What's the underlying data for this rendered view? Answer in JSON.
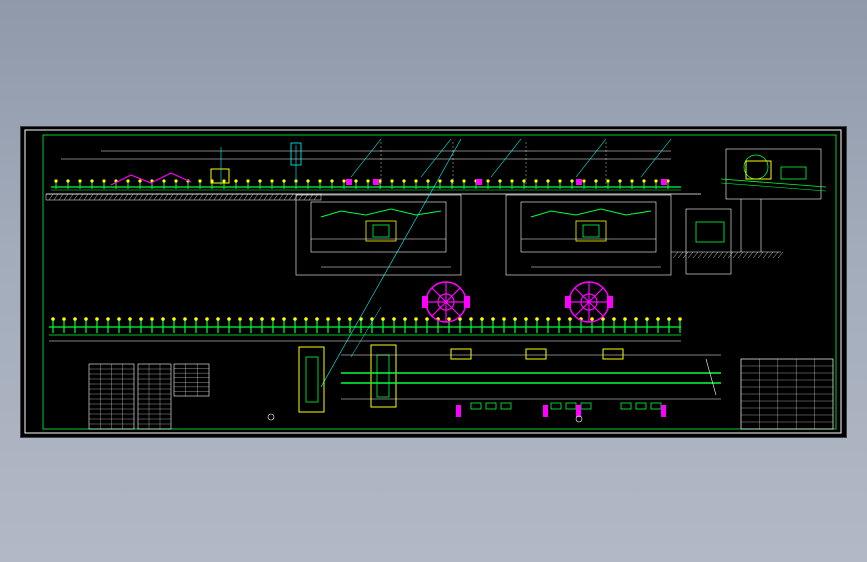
{
  "drawing": {
    "colors": {
      "background": "#000000",
      "frame": "#ffffff",
      "green": "#00ff3c",
      "yellow": "#ffff00",
      "magenta": "#ff00ff",
      "cyan": "#00ffff",
      "white": "#ffffff",
      "dark_green": "#00a020"
    }
  }
}
